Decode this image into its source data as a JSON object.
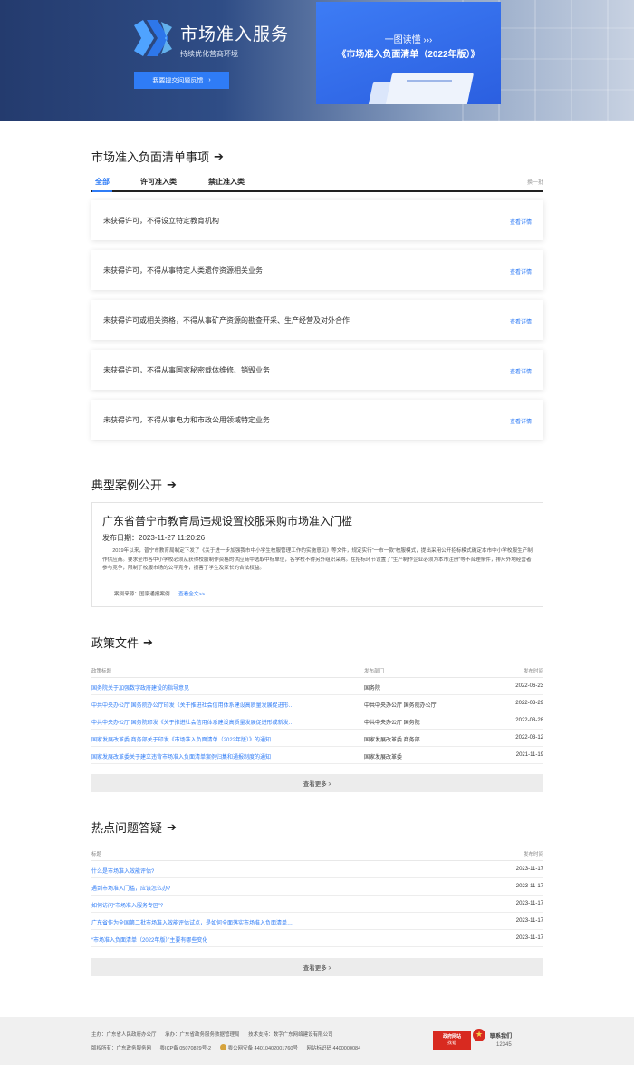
{
  "banner": {
    "title": "市场准入服务",
    "subtitle": "持续优化营商环境",
    "feedback_button": "我要提交问题反馈",
    "feedback_arrow": "›",
    "promo_kicker": "一图读懂 ›››",
    "promo_title": "《市场准入负面清单（2022年版）》"
  },
  "negative_list": {
    "title": "市场准入负面清单事项",
    "arrow": "➔",
    "tabs": [
      {
        "label": "全部",
        "active": true
      },
      {
        "label": "许可准入类",
        "active": false
      },
      {
        "label": "禁止准入类",
        "active": false
      }
    ],
    "switch_label": "换一批",
    "items": [
      {
        "text": "未获得许可，不得设立特定教育机构",
        "link": "查看详情"
      },
      {
        "text": "未获得许可，不得从事特定人类遗传资源相关业务",
        "link": "查看详情"
      },
      {
        "text": "未获得许可或相关资格，不得从事矿产资源的勘查开采、生产经营及对外合作",
        "link": "查看详情"
      },
      {
        "text": "未获得许可，不得从事国家秘密载体维修、销毁业务",
        "link": "查看详情"
      },
      {
        "text": "未获得许可，不得从事电力和市政公用领域特定业务",
        "link": "查看详情"
      }
    ]
  },
  "cases": {
    "title": "典型案例公开",
    "arrow": "➔",
    "case_title": "广东省普宁市教育局违规设置校服采购市场准入门槛",
    "date": "发布日期：2023-11-27 11:20:26",
    "body": "2019年以来，普宁市教育局制定下发了《关于进一步加强我市中小学生校服管理工作的实施意见》等文件，规定实行“一市一款”校服模式，提出采用公开招标模式确定本市中小学校服生产制作供应商。要求全市各中小学校必须从获得校服制作资格的供应商中选取中标单位，各学校不得另外组织采购。在招标环节设置了“生产制作企业必须为本市注册”等不合理条件，排斥外地经营者参与竞争，限制了校服市场的公平竞争，损害了学生及家长的合法权益。",
    "source": "案例来源：国家通报案例",
    "more": "查看全文>>"
  },
  "policy": {
    "title": "政策文件",
    "arrow": "➔",
    "columns": [
      "政策标题",
      "发布部门",
      "发布时间"
    ],
    "rows": [
      {
        "title": "国务院关于加强数字政府建设的指导意见",
        "dept": "国务院",
        "date": "2022-06-23"
      },
      {
        "title": "中共中央办公厅 国务院办公厅印发《关于推进社会信用体系建设高质量发展促进形…",
        "dept": "中共中央办公厅 国务院办公厅",
        "date": "2022-03-29"
      },
      {
        "title": "中共中央办公厅 国务院印发《关于推进社会信用体系建设高质量发展促进形成新发…",
        "dept": "中共中央办公厅 国务院",
        "date": "2022-03-28"
      },
      {
        "title": "国家发展改革委 商务部关于印发《市场准入负面清单（2022年版）》的通知",
        "dept": "国家发展改革委 商务部",
        "date": "2022-03-12"
      },
      {
        "title": "国家发展改革委关于建立违背市场准入负面清单案例归集和通报制度的通知",
        "dept": "国家发展改革委",
        "date": "2021-11-19"
      }
    ],
    "more": "查看更多 >"
  },
  "faq": {
    "title": "热点问题答疑",
    "arrow": "➔",
    "columns": [
      "标题",
      "发布时间"
    ],
    "rows": [
      {
        "title": "什么是市场准入效能评估?",
        "date": "2023-11-17"
      },
      {
        "title": "遇到市场准入门槛，应该怎么办?",
        "date": "2023-11-17"
      },
      {
        "title": "如何访问“市场准入服务专区”?",
        "date": "2023-11-17"
      },
      {
        "title": "广东省作为全国第二批市场准入效能评估试点，是如何全面落实市场准入负面清单…",
        "date": "2023-11-17"
      },
      {
        "title": "“市场准入负面清单（2022年版）”主要有哪些变化",
        "date": "2023-11-17"
      }
    ],
    "more": "查看更多 >"
  },
  "footer": {
    "host": "主办：广东省人民政府办公厅",
    "undertaker": "承办：广东省政务服务数据管理局",
    "tech": "技术支持：数字广东网络建设有限公司",
    "copyright": "版权所有：广东政务服务网",
    "icp": "粤ICP备 05070829号-2",
    "police": "粤公网安备 44010402001760号",
    "site_code": "网站标识码 4400000084",
    "gov_badge_top": "政府网站",
    "gov_badge_bottom": "找错",
    "contact": "联系我们",
    "contact_num": "12345"
  },
  "colors": {
    "accent": "#2f7cf6",
    "banner_dark": "#243b6e",
    "footer_bg": "#f0f0f0",
    "badge_red": "#d82a20"
  }
}
